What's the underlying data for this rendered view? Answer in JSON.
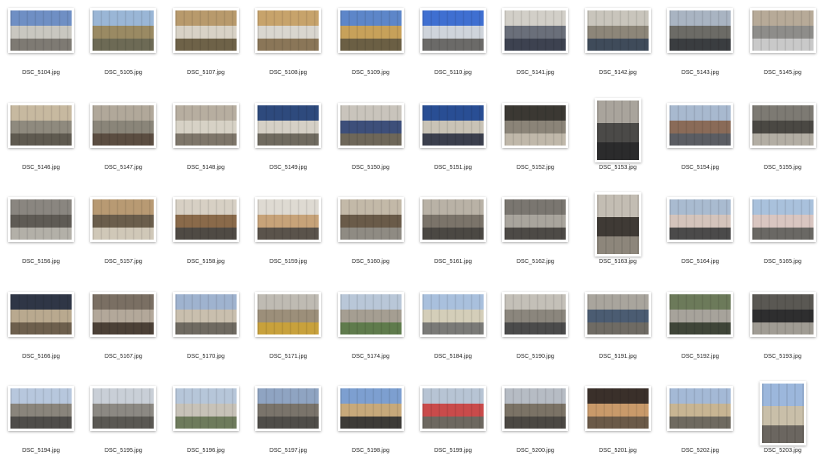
{
  "files": [
    {
      "name": "DSC_5104.jpg",
      "orient": "l",
      "palette": [
        "#6f8fc4",
        "#c9c7c0",
        "#7e7a73"
      ]
    },
    {
      "name": "DSC_5105.jpg",
      "orient": "l",
      "palette": [
        "#9ab6d6",
        "#9a8a63",
        "#6d6a55"
      ]
    },
    {
      "name": "DSC_5107.jpg",
      "orient": "l",
      "palette": [
        "#b89a6c",
        "#d8d2c6",
        "#6e6248"
      ]
    },
    {
      "name": "DSC_5108.jpg",
      "orient": "l",
      "palette": [
        "#c7a36b",
        "#d9d6cf",
        "#8a7658"
      ]
    },
    {
      "name": "DSC_5109.jpg",
      "orient": "l",
      "palette": [
        "#5d86c9",
        "#c7a15a",
        "#6b5f44"
      ]
    },
    {
      "name": "DSC_5110.jpg",
      "orient": "l",
      "palette": [
        "#3f6fd1",
        "#cfd4db",
        "#6b6a68"
      ]
    },
    {
      "name": "DSC_5141.jpg",
      "orient": "l",
      "palette": [
        "#d2cfc8",
        "#6a6f7a",
        "#3d4250"
      ]
    },
    {
      "name": "DSC_5142.jpg",
      "orient": "l",
      "palette": [
        "#c9c5bc",
        "#8d8679",
        "#3f4b5a"
      ]
    },
    {
      "name": "DSC_5143.jpg",
      "orient": "l",
      "palette": [
        "#a9b4c2",
        "#6c6b66",
        "#3a3d40"
      ]
    },
    {
      "name": "DSC_5145.jpg",
      "orient": "l",
      "palette": [
        "#b7aa98",
        "#8e8d8a",
        "#c9c9c9"
      ]
    },
    {
      "name": "DSC_5146.jpg",
      "orient": "l",
      "palette": [
        "#c7b9a0",
        "#8f8a7e",
        "#5f5a50"
      ]
    },
    {
      "name": "DSC_5147.jpg",
      "orient": "l",
      "palette": [
        "#b1a89a",
        "#8a8579",
        "#5b4d41"
      ]
    },
    {
      "name": "DSC_5148.jpg",
      "orient": "l",
      "palette": [
        "#b7aea0",
        "#d7d2c6",
        "#7e766a"
      ]
    },
    {
      "name": "DSC_5149.jpg",
      "orient": "l",
      "palette": [
        "#2e4a7d",
        "#d5d0c6",
        "#6f6a5f"
      ]
    },
    {
      "name": "DSC_5150.jpg",
      "orient": "l",
      "palette": [
        "#c9c4bc",
        "#3d4f7a",
        "#6e6759"
      ]
    },
    {
      "name": "DSC_5151.jpg",
      "orient": "l",
      "palette": [
        "#294e94",
        "#c9c3b6",
        "#3b3f4d"
      ]
    },
    {
      "name": "DSC_5152.jpg",
      "orient": "l",
      "palette": [
        "#3b3833",
        "#8b8478",
        "#c0b8aa"
      ]
    },
    {
      "name": "DSC_5153.jpg",
      "orient": "p",
      "palette": [
        "#a9a49c",
        "#4b4a48",
        "#2b2b2c"
      ]
    },
    {
      "name": "DSC_5154.jpg",
      "orient": "l",
      "palette": [
        "#a8b9cf",
        "#8a6b58",
        "#5b5d63"
      ]
    },
    {
      "name": "DSC_5155.jpg",
      "orient": "l",
      "palette": [
        "#7d7a73",
        "#4a4843",
        "#b3aea4"
      ]
    },
    {
      "name": "DSC_5156.jpg",
      "orient": "l",
      "palette": [
        "#8a8680",
        "#5f5b55",
        "#b3b0a8"
      ]
    },
    {
      "name": "DSC_5157.jpg",
      "orient": "l",
      "palette": [
        "#b89a73",
        "#6b5e4c",
        "#d0c8b8"
      ]
    },
    {
      "name": "DSC_5158.jpg",
      "orient": "l",
      "palette": [
        "#d7d0c4",
        "#8a6a4a",
        "#4f4a44"
      ]
    },
    {
      "name": "DSC_5159.jpg",
      "orient": "l",
      "palette": [
        "#dedad2",
        "#c7a379",
        "#5a534b"
      ]
    },
    {
      "name": "DSC_5160.jpg",
      "orient": "l",
      "palette": [
        "#c3b9a8",
        "#6a5b49",
        "#8f8b83"
      ]
    },
    {
      "name": "DSC_5161.jpg",
      "orient": "l",
      "palette": [
        "#b9b2a6",
        "#7b746a",
        "#4b4843"
      ]
    },
    {
      "name": "DSC_5162.jpg",
      "orient": "l",
      "palette": [
        "#7a7670",
        "#a9a59d",
        "#4d4a46"
      ]
    },
    {
      "name": "DSC_5163.jpg",
      "orient": "p",
      "palette": [
        "#c3bdb3",
        "#3f3a35",
        "#8d867b"
      ]
    },
    {
      "name": "DSC_5164.jpg",
      "orient": "l",
      "palette": [
        "#a9bbd0",
        "#d4c4bc",
        "#4b4a4a"
      ]
    },
    {
      "name": "DSC_5165.jpg",
      "orient": "l",
      "palette": [
        "#a9c1dc",
        "#d9c6c1",
        "#6a6864"
      ]
    },
    {
      "name": "DSC_5166.jpg",
      "orient": "l",
      "palette": [
        "#2f3646",
        "#b9a98f",
        "#6d5f4d"
      ]
    },
    {
      "name": "DSC_5167.jpg",
      "orient": "l",
      "palette": [
        "#7a6f63",
        "#b3a89a",
        "#4b4036"
      ]
    },
    {
      "name": "DSC_5170.jpg",
      "orient": "l",
      "palette": [
        "#9fb3cf",
        "#c9bfae",
        "#6f6a61"
      ]
    },
    {
      "name": "DSC_5171.jpg",
      "orient": "l",
      "palette": [
        "#bfbbb3",
        "#9c8f7a",
        "#c8a13c"
      ]
    },
    {
      "name": "DSC_5174.jpg",
      "orient": "l",
      "palette": [
        "#b9c7d8",
        "#a59e92",
        "#5f7b4c"
      ]
    },
    {
      "name": "DSC_5184.jpg",
      "orient": "l",
      "palette": [
        "#a9c0dd",
        "#d4ceb9",
        "#7a7a77"
      ]
    },
    {
      "name": "DSC_5190.jpg",
      "orient": "l",
      "palette": [
        "#c4c0b8",
        "#8b867d",
        "#4b4b4b"
      ]
    },
    {
      "name": "DSC_5191.jpg",
      "orient": "l",
      "palette": [
        "#a9a59d",
        "#4b5c72",
        "#6f6b64"
      ]
    },
    {
      "name": "DSC_5192.jpg",
      "orient": "l",
      "palette": [
        "#6c7a5a",
        "#a7a39b",
        "#3f4538"
      ]
    },
    {
      "name": "DSC_5193.jpg",
      "orient": "l",
      "palette": [
        "#5a5853",
        "#2e2e2f",
        "#a09c94"
      ]
    },
    {
      "name": "DSC_5194.jpg",
      "orient": "l",
      "palette": [
        "#b7c7dd",
        "#8a857c",
        "#4f4d4a"
      ]
    },
    {
      "name": "DSC_5195.jpg",
      "orient": "l",
      "palette": [
        "#c9cfd7",
        "#8c8983",
        "#5a5853"
      ]
    },
    {
      "name": "DSC_5196.jpg",
      "orient": "l",
      "palette": [
        "#b6c6d9",
        "#c7c2b8",
        "#6e7b5c"
      ]
    },
    {
      "name": "DSC_5197.jpg",
      "orient": "l",
      "palette": [
        "#8fa4c2",
        "#7a746b",
        "#4f4d49"
      ]
    },
    {
      "name": "DSC_5198.jpg",
      "orient": "l",
      "palette": [
        "#7d9fd0",
        "#c7a97b",
        "#3d3b37"
      ]
    },
    {
      "name": "DSC_5199.jpg",
      "orient": "l",
      "palette": [
        "#b7c4d4",
        "#c94b4b",
        "#6d6860"
      ]
    },
    {
      "name": "DSC_5200.jpg",
      "orient": "l",
      "palette": [
        "#b6bcc4",
        "#7b7366",
        "#4b4843"
      ]
    },
    {
      "name": "DSC_5201.jpg",
      "orient": "l",
      "palette": [
        "#3a302a",
        "#c99a6a",
        "#6b5a48"
      ]
    },
    {
      "name": "DSC_5202.jpg",
      "orient": "l",
      "palette": [
        "#a4b9d6",
        "#c8b593",
        "#6f6a60"
      ]
    },
    {
      "name": "DSC_5203.jpg",
      "orient": "p",
      "palette": [
        "#9cb7dc",
        "#c9bfa9",
        "#6b6660"
      ]
    }
  ]
}
